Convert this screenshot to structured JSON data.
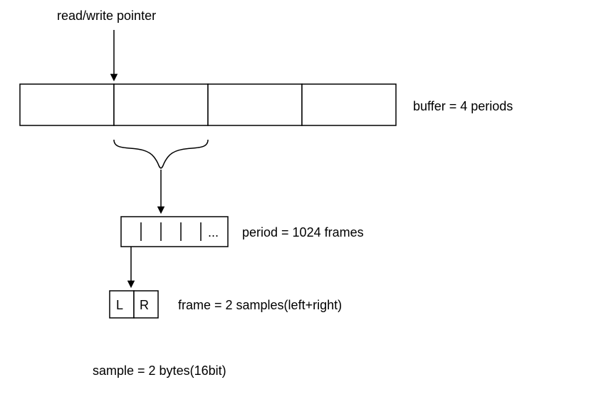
{
  "pointer_label": "read/write pointer",
  "buffer_label": "buffer = 4 periods",
  "period_label": "period = 1024 frames",
  "period_ellipsis": "...",
  "frame_left": "L",
  "frame_right": "R",
  "frame_label": "frame = 2 samples(left+right)",
  "sample_label": "sample = 2 bytes(16bit)",
  "chart_data": {
    "type": "table",
    "title": "Audio buffer hierarchy",
    "rows": [
      {
        "level": "buffer",
        "composed_of": "periods",
        "count": 4
      },
      {
        "level": "period",
        "composed_of": "frames",
        "count": 1024
      },
      {
        "level": "frame",
        "composed_of": "samples",
        "count": 2,
        "channels": [
          "left",
          "right"
        ]
      },
      {
        "level": "sample",
        "composed_of": "bytes",
        "count": 2,
        "bits": 16
      }
    ]
  }
}
